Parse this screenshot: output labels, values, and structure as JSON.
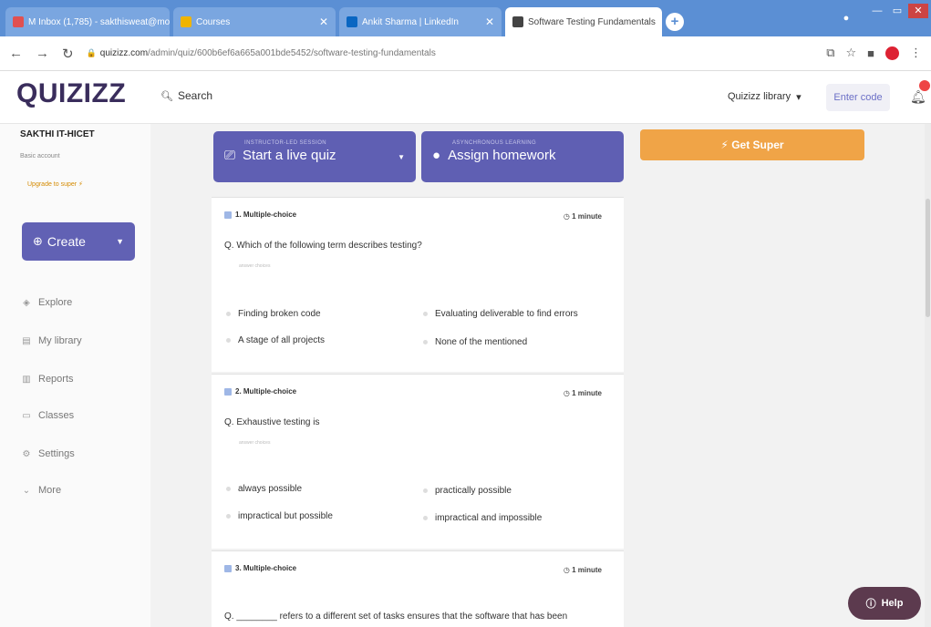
{
  "browser": {
    "tabs": [
      {
        "title": "M Inbox (1,785) - sakthisweat@mo",
        "favicon_color": "#e05050"
      },
      {
        "title": "Courses",
        "favicon_color": "#f0b400"
      },
      {
        "title": "Ankit Sharma | LinkedIn",
        "favicon_color": "#0a66c2"
      },
      {
        "title": "Software Testing Fundamentals",
        "favicon_color": "#444444"
      }
    ],
    "url_host": "quizizz.com",
    "url_path": "/admin/quiz/600b6ef6a665a001bde5452/software-testing-fundamentals"
  },
  "header": {
    "logo": "QUIZIZZ",
    "search_label": "Search",
    "library_label": "Quizizz library",
    "enter_code_label": "Enter code"
  },
  "sidebar": {
    "username": "SAKTHI IT-HICET",
    "account_type": "Basic account",
    "upgrade_label": "Upgrade to super",
    "create_label": "Create",
    "nav": [
      {
        "label": "Explore",
        "icon": "compass-icon"
      },
      {
        "label": "My library",
        "icon": "library-icon"
      },
      {
        "label": "Reports",
        "icon": "reports-icon"
      },
      {
        "label": "Classes",
        "icon": "classes-icon"
      },
      {
        "label": "Settings",
        "icon": "settings-icon"
      },
      {
        "label": "More",
        "icon": "chevron-down-icon"
      }
    ]
  },
  "actions": {
    "live": {
      "small": "INSTRUCTOR-LED SESSION",
      "big": "Start a live quiz"
    },
    "homework": {
      "small": "ASYNCHRONOUS LEARNING",
      "big": "Assign homework"
    }
  },
  "get_super_label": "Get Super",
  "help_label": "Help",
  "questions": [
    {
      "header": "1. Multiple-choice",
      "time": "1 minute",
      "text": "Q. Which of the following term describes testing?",
      "choices_label": "answer choices",
      "options": [
        "Finding broken code",
        "Evaluating deliverable to find errors",
        "A stage of all projects",
        "None of the mentioned"
      ]
    },
    {
      "header": "2. Multiple-choice",
      "time": "1 minute",
      "text": "Q. Exhaustive testing is",
      "choices_label": "answer choices",
      "options": [
        "always possible",
        "practically possible",
        "impractical but possible",
        "impractical and impossible"
      ]
    },
    {
      "header": "3. Multiple-choice",
      "time": "1 minute",
      "text": "Q. ________ refers to a different set of tasks ensures that the software that has been"
    }
  ],
  "colors": {
    "primary": "#5f5fb3",
    "accent": "#f0a447",
    "help": "#5c3a4e"
  }
}
